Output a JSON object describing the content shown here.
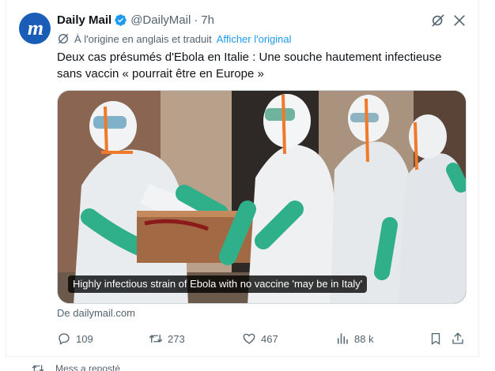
{
  "tweet": {
    "display_name": "Daily Mail",
    "handle": "@DailyMail",
    "separator": "·",
    "time": "7h",
    "avatar_letter": "m",
    "translation_note": "À l'origine en anglais et traduit",
    "translation_link": "Afficher l'original",
    "text": "Deux cas présumés d'Ebola en Italie : Une souche hautement infectieuse sans vaccin « pourrait être en Europe »",
    "media_caption": "Highly infectious strain of Ebola with no vaccine 'may be in Italy'",
    "source": "De dailymail.com",
    "stats": {
      "replies": "109",
      "retweets": "273",
      "likes": "467",
      "views": "88 k"
    }
  },
  "next_item": {
    "label": "Mess a reposté"
  },
  "colors": {
    "brand_blue": "#1a5db8",
    "link": "#1d9bf0",
    "muted": "#536471",
    "verified": "#1d9bf0"
  },
  "icons": [
    "verified-badge-icon",
    "grok-icon",
    "more-icon",
    "translate-icon",
    "reply-icon",
    "retweet-icon",
    "like-icon",
    "views-icon",
    "bookmark-icon",
    "share-icon"
  ]
}
